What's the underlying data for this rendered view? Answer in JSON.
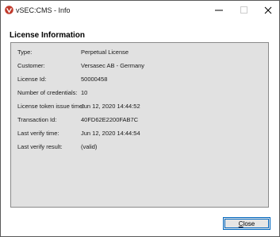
{
  "window": {
    "title": "vSEC:CMS - Info"
  },
  "section_title": "License Information",
  "license": [
    {
      "label": "Type:",
      "value": "Perpetual License"
    },
    {
      "label": "Customer:",
      "value": "Versasec AB - Germany"
    },
    {
      "label": "License Id:",
      "value": "50000458"
    },
    {
      "label": "Number of credentials:",
      "value": "10"
    },
    {
      "label": "License token issue time:",
      "value": "Jun 12, 2020 14:44:52"
    },
    {
      "label": "Transaction Id:",
      "value": "40FD62E2200FAB7C"
    },
    {
      "label": "Last verify time:",
      "value": "Jun 12, 2020 14:44:54"
    },
    {
      "label": "Last verify result:",
      "value": "(valid)"
    }
  ],
  "buttons": {
    "close_mnemonic": "C",
    "close_rest": "lose"
  },
  "colors": {
    "panel_bg": "#e1e1e1",
    "accent": "#0067c0",
    "app_icon": "#c0392b"
  },
  "icons": {
    "app": "vsec-app-icon",
    "minimize": "minimize-icon",
    "maximize": "maximize-icon",
    "close": "close-icon"
  }
}
